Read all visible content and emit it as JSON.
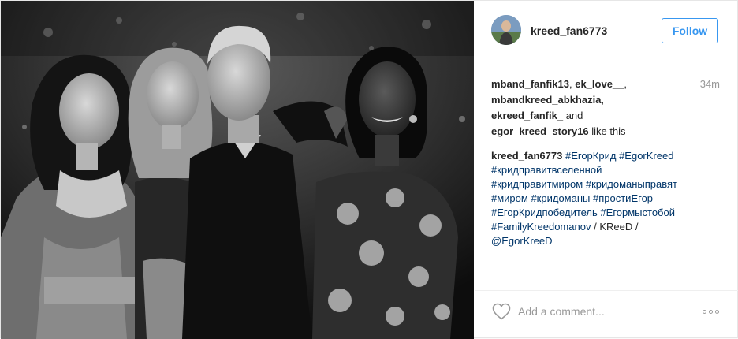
{
  "post": {
    "author": "kreed_fan6773",
    "follow_label": "Follow",
    "time": "34m",
    "likes": {
      "users": [
        "mband_fanfik13",
        "ek_love__",
        "mbandkreed_abkhazia",
        "ekreed_fanfik_",
        "egor_kreed_story16"
      ],
      "and_text": "and",
      "suffix": "like this"
    },
    "caption": {
      "author": "kreed_fan6773",
      "tags": [
        "#ЕгорКрид",
        "#EgorKreed",
        "#кридправитвселенной",
        "#кридправитмиром",
        "#кридоманыправят",
        "#миром",
        "#кридоманы",
        "#простиЕгор",
        "#ЕгорКридпобедитель",
        "#Егормыстобой",
        "#FamilyKreedomanov",
        "/",
        "KReeD",
        "/",
        "@EgorKreeD"
      ]
    },
    "comment_placeholder": "Add a comment...",
    "icons": {
      "like": "heart-outline-icon",
      "more": "more-options-icon"
    }
  }
}
